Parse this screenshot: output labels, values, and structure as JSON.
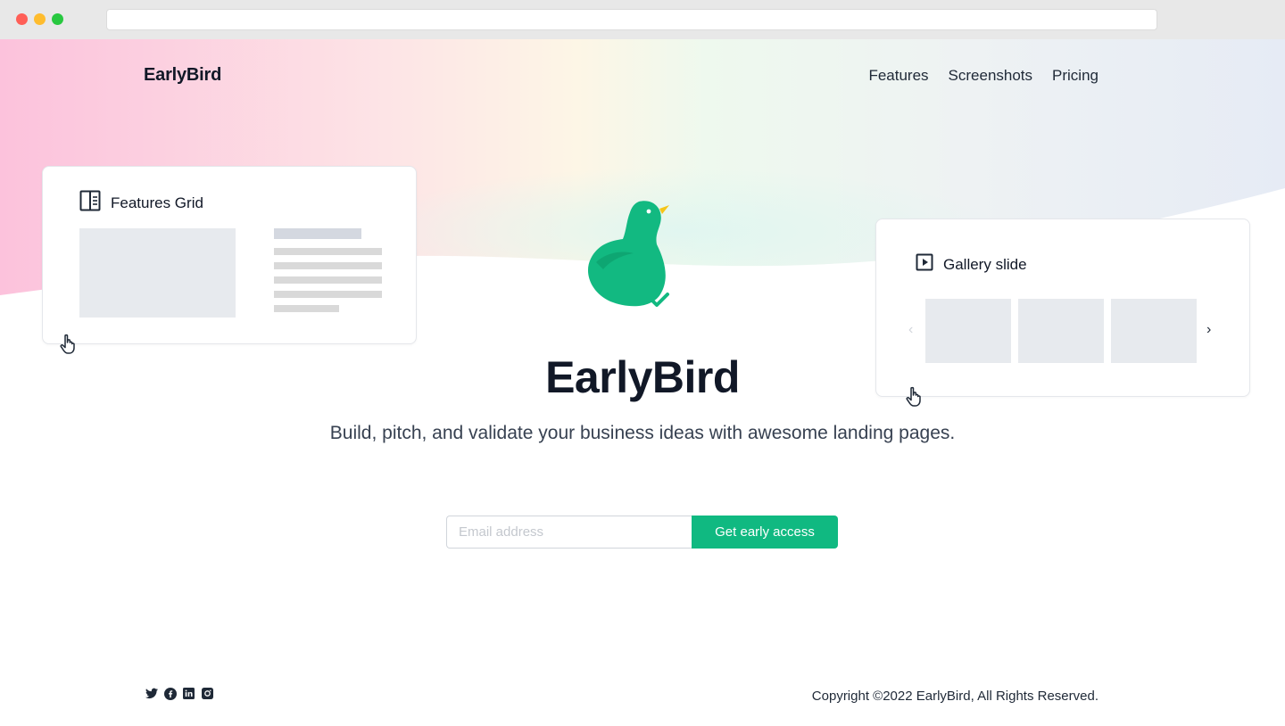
{
  "brand": {
    "name": "EarlyBird"
  },
  "nav": {
    "items": [
      "Features",
      "Screenshots",
      "Pricing"
    ]
  },
  "cards": {
    "features": {
      "title": "Features Grid",
      "icon": "layout-icon"
    },
    "gallery": {
      "title": "Gallery slide",
      "icon": "play-square-icon"
    }
  },
  "hero": {
    "title": "EarlyBird",
    "subtitle": "Build, pitch, and validate your business ideas with awesome landing pages."
  },
  "signup": {
    "placeholder": "Email address",
    "button_label": "Get early access"
  },
  "footer": {
    "social_icons": [
      "twitter-icon",
      "facebook-icon",
      "linkedin-icon",
      "instagram-icon"
    ],
    "copyright": "Copyright ©2022 EarlyBird, All Rights Reserved."
  },
  "colors": {
    "accent": "#10b981",
    "bird": "#12b981",
    "beak": "#f5c518",
    "text": "#111827"
  }
}
